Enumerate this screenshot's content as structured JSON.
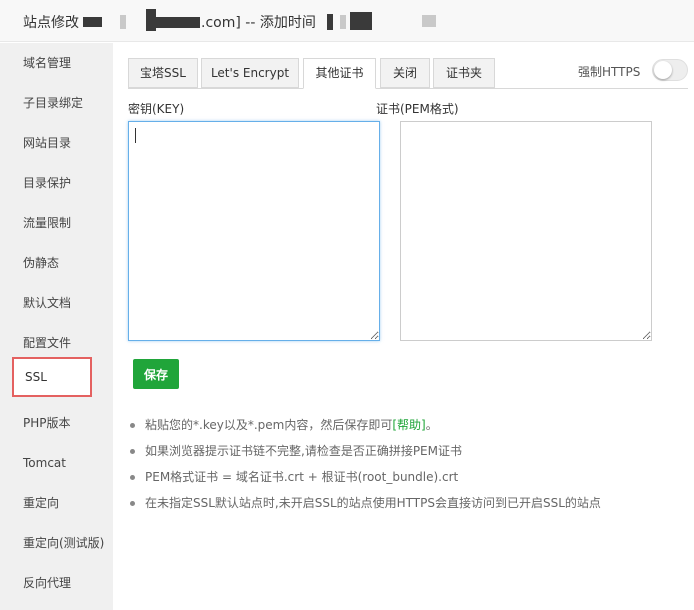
{
  "window": {
    "title_prefix": "站点修改",
    "title_mid": ".com] -- 添加时间"
  },
  "sidebar": {
    "items": [
      {
        "label": "域名管理"
      },
      {
        "label": "子目录绑定"
      },
      {
        "label": "网站目录"
      },
      {
        "label": "目录保护"
      },
      {
        "label": "流量限制"
      },
      {
        "label": "伪静态"
      },
      {
        "label": "默认文档"
      },
      {
        "label": "配置文件"
      },
      {
        "label": "SSL",
        "active": true
      },
      {
        "label": "PHP版本"
      },
      {
        "label": "Tomcat"
      },
      {
        "label": "重定向"
      },
      {
        "label": "重定向(测试版)"
      },
      {
        "label": "反向代理"
      }
    ]
  },
  "tabs": [
    {
      "label": "宝塔SSL"
    },
    {
      "label": "Let's Encrypt"
    },
    {
      "label": "其他证书",
      "active": true
    },
    {
      "label": "关闭"
    },
    {
      "label": "证书夹"
    }
  ],
  "force_https": {
    "label": "强制HTTPS",
    "enabled": false
  },
  "key_field": {
    "label": "密钥(KEY)",
    "value": ""
  },
  "cert_field": {
    "label": "证书(PEM格式)",
    "value": ""
  },
  "save_button": {
    "label": "保存"
  },
  "tips": {
    "line1_prefix": "粘贴您的*.key以及*.pem内容，然后保存即可",
    "line1_link": "[帮助]",
    "line1_suffix": "。",
    "line2": "如果浏览器提示证书链不完整,请检查是否正确拼接PEM证书",
    "line3": "PEM格式证书 = 域名证书.crt + 根证书(root_bundle).crt",
    "line4": "在未指定SSL默认站点时,未开启SSL的站点使用HTTPS会直接访问到已开启SSL的站点"
  },
  "colors": {
    "accent": "#20a53a",
    "highlight_border": "#e46160"
  }
}
